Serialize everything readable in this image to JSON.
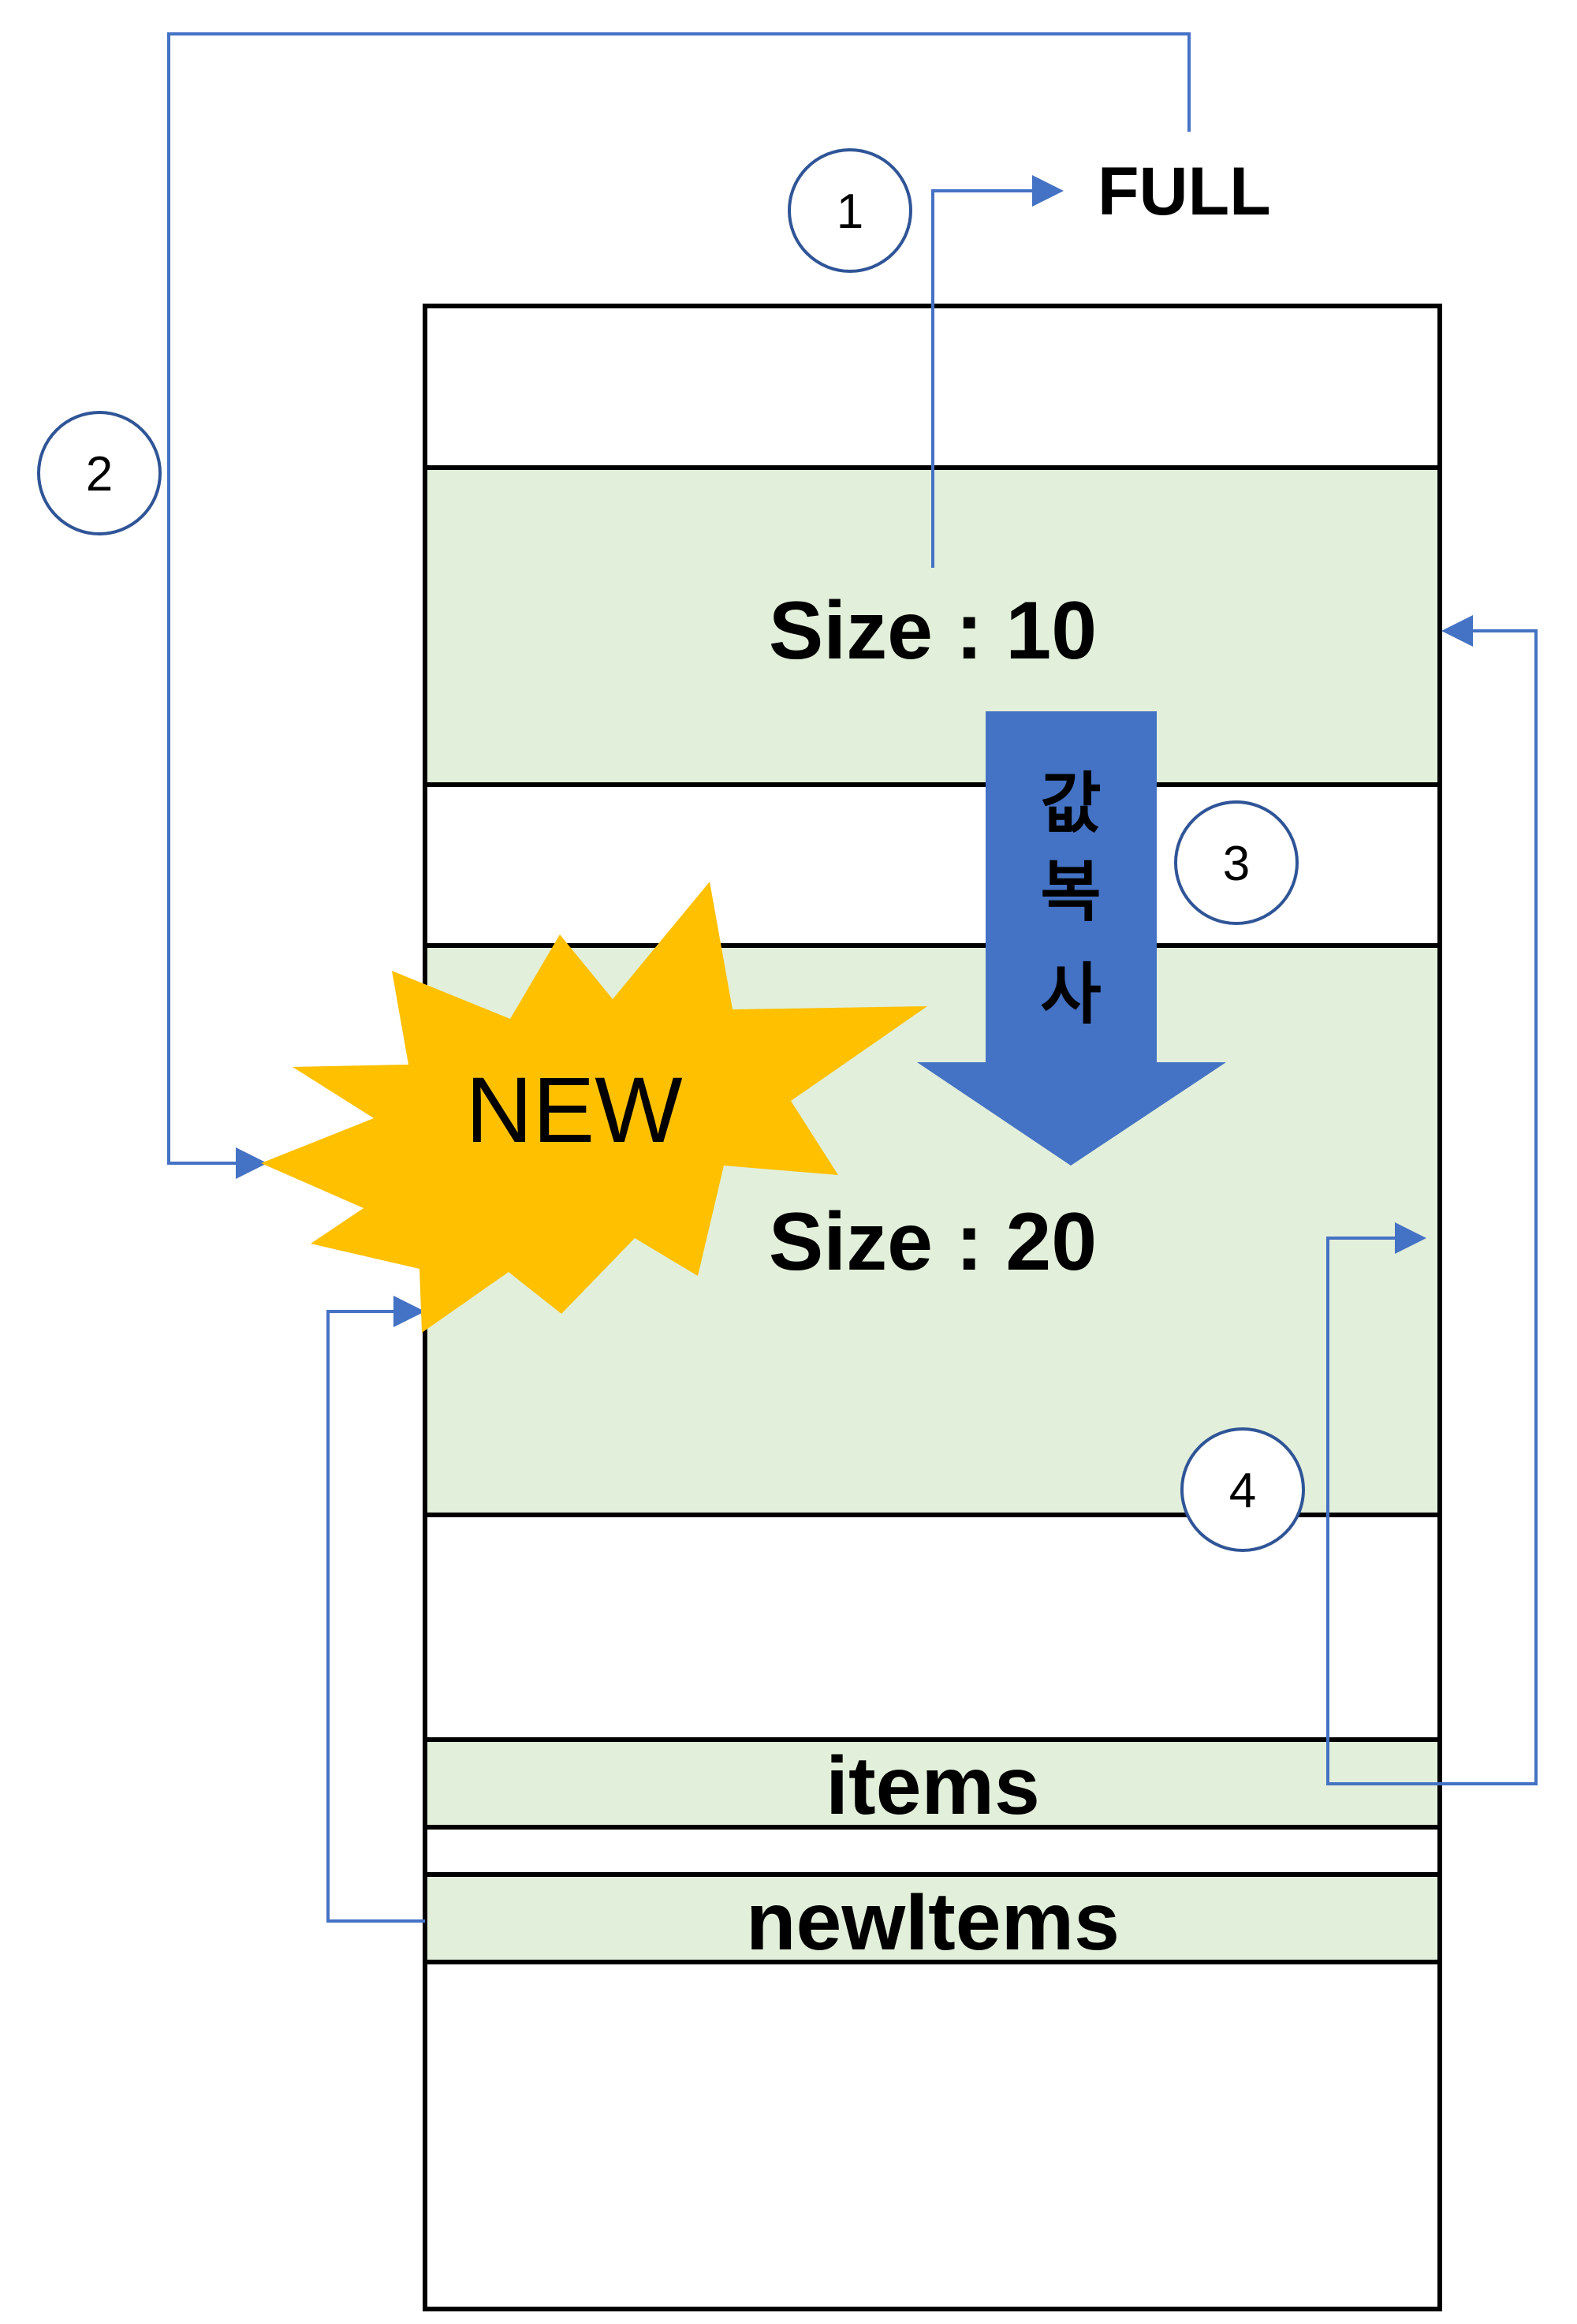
{
  "labels": {
    "full": "FULL",
    "old_array": "Size : 10",
    "new_array": "Size : 20",
    "items": "items",
    "new_items": "newItems",
    "new_burst": "NEW",
    "copy_chars": [
      "값",
      "복",
      "사"
    ]
  },
  "steps": [
    "1",
    "2",
    "3",
    "4"
  ],
  "colors": {
    "cell_fill": "#e2efda",
    "border": "#000000",
    "arrow": "#4472c4",
    "burst": "#ffc000",
    "step_circle_stroke": "#2f5597"
  },
  "icons": {
    "copy_arrow": "down-arrow",
    "burst": "starburst"
  }
}
